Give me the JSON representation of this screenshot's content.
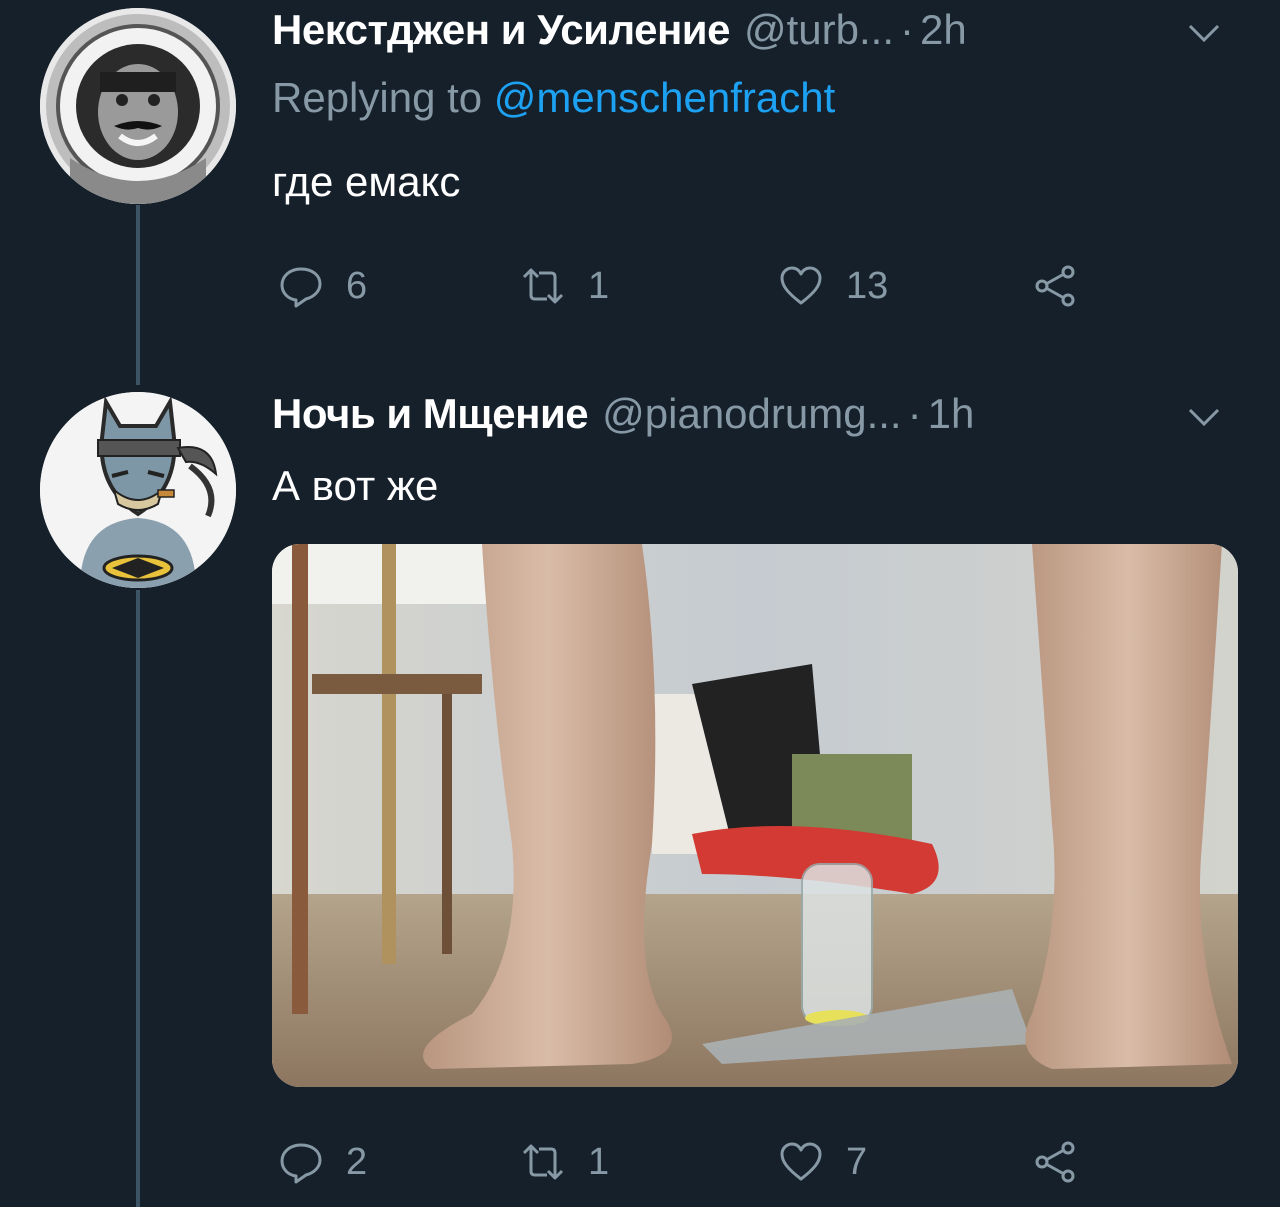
{
  "tweets": [
    {
      "author_name": "Некстджен и Усиление",
      "handle": "@turb...",
      "separator": "·",
      "time": "2h",
      "replying_prefix": "Replying to ",
      "replying_to": "@menschenfracht",
      "text": "где емакс",
      "replies": "6",
      "retweets": "1",
      "likes": "13",
      "avatar_icon": "astronaut-portrait-avatar"
    },
    {
      "author_name": "Ночь и Мщение",
      "handle": "@pianodrumg...",
      "separator": "·",
      "time": "1h",
      "text": "А вот же",
      "replies": "2",
      "retweets": "1",
      "likes": "7",
      "avatar_icon": "batman-cartoon-avatar",
      "media": "photo-legs-and-glass-jar"
    }
  ],
  "icons": {
    "reply": "reply-icon",
    "retweet": "retweet-icon",
    "like": "like-icon",
    "share": "share-icon",
    "menu": "chevron-down-icon"
  },
  "colors": {
    "background": "#15202b",
    "secondary_text": "#8899a6",
    "mention": "#1da1f2",
    "thread_line": "#3d5466"
  }
}
